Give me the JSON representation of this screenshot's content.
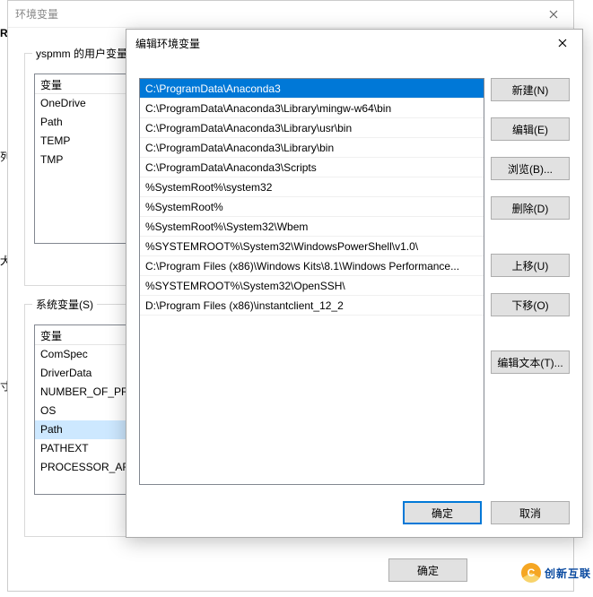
{
  "back_window": {
    "title": "环境变量",
    "user_group_legend": "yspmm 的用户变量",
    "sys_group_legend": "系统变量(S)",
    "col_variable": "变量",
    "user_vars": [
      "OneDrive",
      "Path",
      "TEMP",
      "TMP"
    ],
    "sys_vars": [
      "ComSpec",
      "DriverData",
      "NUMBER_OF_PROCESSORS",
      "OS",
      "Path",
      "PATHEXT",
      "PROCESSOR_ARCHITECTURE"
    ],
    "sys_selected_index": 4,
    "ok_label": "确定"
  },
  "front_window": {
    "title": "编辑环境变量",
    "paths": [
      "C:\\ProgramData\\Anaconda3",
      "C:\\ProgramData\\Anaconda3\\Library\\mingw-w64\\bin",
      "C:\\ProgramData\\Anaconda3\\Library\\usr\\bin",
      "C:\\ProgramData\\Anaconda3\\Library\\bin",
      "C:\\ProgramData\\Anaconda3\\Scripts",
      "%SystemRoot%\\system32",
      "%SystemRoot%",
      "%SystemRoot%\\System32\\Wbem",
      "%SYSTEMROOT%\\System32\\WindowsPowerShell\\v1.0\\",
      "C:\\Program Files (x86)\\Windows Kits\\8.1\\Windows Performance...",
      "%SYSTEMROOT%\\System32\\OpenSSH\\",
      "D:\\Program Files (x86)\\instantclient_12_2"
    ],
    "selected_index": 0,
    "buttons": {
      "new": "新建(N)",
      "edit": "编辑(E)",
      "browse": "浏览(B)...",
      "delete": "删除(D)",
      "up": "上移(U)",
      "down": "下移(O)",
      "edit_text": "编辑文本(T)..."
    },
    "ok_label": "确定",
    "cancel_label": "取消"
  },
  "edge_chars": {
    "a": "R",
    "b": "列",
    "c": "犬",
    "d": "寸"
  },
  "watermark": {
    "logo_char": "C",
    "text": "创新互联"
  }
}
